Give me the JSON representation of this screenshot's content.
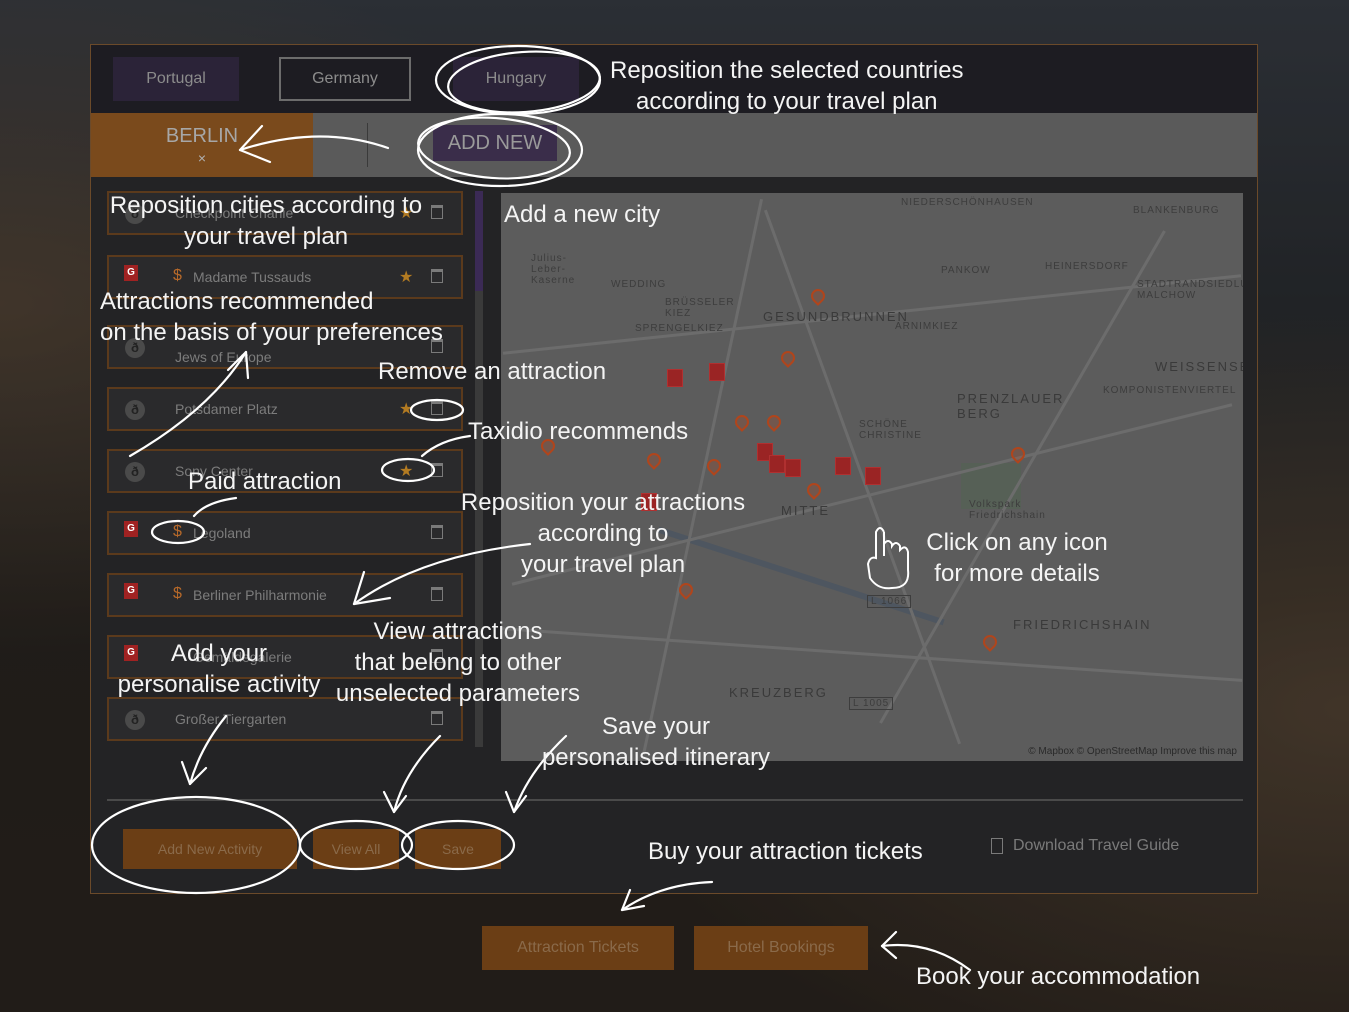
{
  "countries": [
    {
      "label": "Portugal"
    },
    {
      "label": "Germany"
    },
    {
      "label": "Hungary"
    }
  ],
  "city_tab": {
    "label": "BERLIN",
    "remove_icon": "×"
  },
  "add_new_city": {
    "label": "ADD NEW"
  },
  "attractions": [
    {
      "name": "Checkpoint Charlie",
      "type": "wiki",
      "paid": false,
      "recommended": true
    },
    {
      "name": "Madame Tussauds",
      "type": "google",
      "paid": true,
      "recommended": true
    },
    {
      "name": "Jews of Europe",
      "type": "wiki",
      "paid": false,
      "recommended": false
    },
    {
      "name": "Potsdamer Platz",
      "type": "wiki",
      "paid": false,
      "recommended": true
    },
    {
      "name": "Sony Center",
      "type": "wiki",
      "paid": false,
      "recommended": true
    },
    {
      "name": "Legoland",
      "type": "google",
      "paid": true,
      "recommended": false
    },
    {
      "name": "Berliner Philharmonie",
      "type": "google",
      "paid": true,
      "recommended": false
    },
    {
      "name": "Gemäldegalerie",
      "type": "google",
      "paid": false,
      "recommended": false
    },
    {
      "name": "Großer Tiergarten",
      "type": "wiki",
      "paid": false,
      "recommended": false
    }
  ],
  "map": {
    "labels": [
      "WEDDING",
      "GESUNDBRUNNEN",
      "PANKOW",
      "HEINERSDORF",
      "PRENZLAUER BERG",
      "WEISSENSEE",
      "MITTE",
      "FRIEDRICHSHAIN",
      "KREUZBERG",
      "SCHÖNE CHRISTINE",
      "NIEDERSCHÖNHAUSEN",
      "BLANKENBURG",
      "KOMPONISTENVIERTEL",
      "ARNIMKIEZ",
      "SPRENGELKIEZ",
      "BRÜSSELER KIEZ",
      "Volkspark Friedrichshain",
      "Julius-Leber-Kaserne",
      "STADTRANDSIEDLUNG MALCHOW",
      "L 1066",
      "L 1005"
    ],
    "attribution": "© Mapbox © OpenStreetMap Improve this map"
  },
  "bottom": {
    "add_activity": "Add New Activity",
    "view_all": "View All",
    "save": "Save",
    "download": "Download Travel Guide"
  },
  "external": {
    "tickets": "Attraction Tickets",
    "hotels": "Hotel Bookings"
  },
  "annotations": {
    "countries": [
      "Reposition the selected  countries",
      "according to your travel plan"
    ],
    "cities": [
      "Reposition cities according to",
      "your travel plan"
    ],
    "add_city": "Add a new city",
    "recommended": [
      "Attractions recommended",
      "on the basis of your preferences"
    ],
    "remove": "Remove an attraction",
    "taxidio": "Taxidio recommends",
    "paid": "Paid attraction",
    "reposition_attr": [
      "Reposition your attractions",
      "according to",
      "your travel plan"
    ],
    "click_icon": [
      "Click on any icon",
      "for more details"
    ],
    "view_other": [
      "View attractions",
      "that belong to other",
      "unselected parameters"
    ],
    "add_personal": [
      "Add your",
      "personalise activity"
    ],
    "save_itinerary": [
      "Save your",
      "personalised itinerary"
    ],
    "buy_tickets": "Buy your attraction tickets",
    "book_accommodation": "Book your accommodation"
  },
  "colors": {
    "accent_orange": "#7a4a1c",
    "purple": "#2b2338",
    "annotation": "#f4f4f4"
  }
}
